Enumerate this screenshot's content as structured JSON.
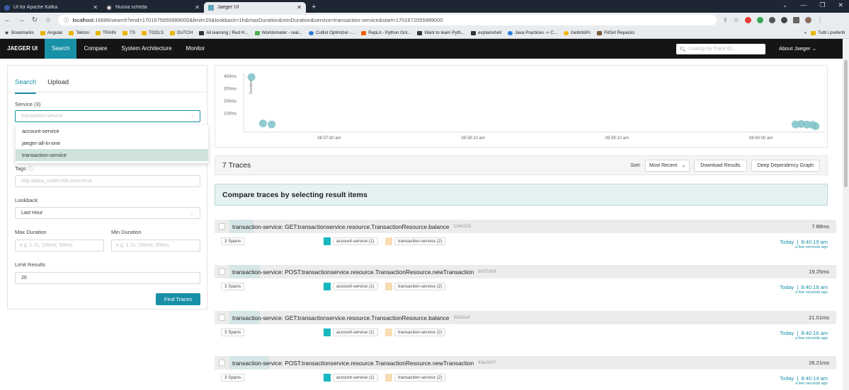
{
  "browser": {
    "tabs": [
      {
        "label": "UI for Apache Kafka",
        "icon": "kafka-icon",
        "active": false
      },
      {
        "label": "Nuova scheda",
        "icon": "chrome-icon",
        "active": false
      },
      {
        "label": "Jaeger UI",
        "icon": "jaeger-icon",
        "active": true
      }
    ],
    "url_host": "localhost",
    "url_rest": ":16686/search?end=1701675655989000&limit=20&lookback=1h&maxDuration&minDuration&service=transaction-service&start=1701672055989000",
    "bookmarks": [
      {
        "label": "Bookmarks",
        "icon": "star"
      },
      {
        "label": "Angular",
        "icon": "folder"
      },
      {
        "label": "Tekton",
        "icon": "folder"
      },
      {
        "label": "TRAIN",
        "icon": "folder"
      },
      {
        "label": "TS",
        "icon": "folder"
      },
      {
        "label": "TOOLS",
        "icon": "folder"
      },
      {
        "label": "DUTCH",
        "icon": "folder"
      },
      {
        "label": "All learning | Red H...",
        "icon": "redhat"
      },
      {
        "label": "Worldometer - real...",
        "icon": "worldometer"
      },
      {
        "label": "Cutlist Optimizer -...",
        "icon": "cutlist"
      },
      {
        "label": "RepLit - Python Onl...",
        "icon": "replit"
      },
      {
        "label": "Want to learn Pyth...",
        "icon": "python"
      },
      {
        "label": "explainshell",
        "icon": "shell"
      },
      {
        "label": "Java Practices -> C...",
        "icon": "java"
      },
      {
        "label": "GetIntoPc",
        "icon": "getintopc"
      },
      {
        "label": "FitGirl Repacks",
        "icon": "fitgirl"
      }
    ],
    "bookmarks_more": "»",
    "bookmarks_other": "Tutti i preferiti"
  },
  "nav": {
    "brand": "JAEGER UI",
    "items": [
      "Search",
      "Compare",
      "System Architecture",
      "Monitor"
    ],
    "lookup_placeholder": "Lookup by Trace ID...",
    "about": "About Jaeger"
  },
  "search": {
    "tab_search": "Search",
    "tab_upload": "Upload",
    "service_label": "Service (3)",
    "service_value": "transaction-service",
    "service_options": [
      "account-service",
      "jaeger-all-in-one",
      "transaction-service"
    ],
    "tags_label": "Tags",
    "tags_placeholder": "http.status_code=200 error=true",
    "lookback_label": "Lookback",
    "lookback_value": "Last Hour",
    "max_label": "Max Duration",
    "min_label": "Min Duration",
    "max_placeholder": "e.g. 1.2s, 100ms, 500us",
    "min_placeholder": "e.g. 1.2s, 100ms, 500us",
    "limit_label": "Limit Results",
    "limit_value": "20",
    "find_button": "Find Traces"
  },
  "chart_data": {
    "type": "scatter",
    "ylabel": "Duration",
    "y_ticks": [
      "400ms",
      "300ms",
      "200ms",
      "100ms"
    ],
    "x_ticks": [
      "08:37:30 am",
      "08:38:20 am",
      "08:39:10 am",
      "08:40:00 am"
    ],
    "points": [
      {
        "x": "08:37:03 am",
        "y": 405
      },
      {
        "x": "08:37:07 am",
        "y": 30
      },
      {
        "x": "08:37:10 am",
        "y": 22
      },
      {
        "x": "08:40:12 am",
        "y": 22
      },
      {
        "x": "08:40:14 am",
        "y": 26
      },
      {
        "x": "08:40:16 am",
        "y": 21
      },
      {
        "x": "08:40:18 am",
        "y": 19
      },
      {
        "x": "08:40:19 am",
        "y": 8
      }
    ],
    "point_color": "#7ec2c7"
  },
  "results": {
    "count": "7 Traces",
    "sort_label": "Sort:",
    "sort_value": "Most Recent",
    "download": "Download Results",
    "deep_dependency": "Deep Dependency Graph",
    "compare_banner": "Compare traces by selecting result items",
    "traces": [
      {
        "name": "transaction-service: GET:transactionservice.resource.TransactionResource.balance",
        "id": "1340325",
        "duration": "7.88ms",
        "duration_fraction": 0.04,
        "spans": "3 Spans",
        "svc1": "account-service (1)",
        "svc2": "transaction-service (2)",
        "day": "Today",
        "time": "8:40:19 am",
        "ago": "a few seconds ago"
      },
      {
        "name": "transaction-service: POST:transactionservice.resource.TransactionResource.newTransaction",
        "id": "6037d09",
        "duration": "19.25ms",
        "duration_fraction": 0.05,
        "spans": "3 Spans",
        "svc1": "account-service (1)",
        "svc2": "transaction-service (2)",
        "day": "Today",
        "time": "8:40:18 am",
        "ago": "a few seconds ago"
      },
      {
        "name": "transaction-service: GET:transactionservice.resource.TransactionResource.balance",
        "id": "9d20cef",
        "duration": "21.01ms",
        "duration_fraction": 0.05,
        "spans": "3 Spans",
        "svc1": "account-service (1)",
        "svc2": "transaction-service (2)",
        "day": "Today",
        "time": "8:40:16 am",
        "ago": "a few seconds ago"
      },
      {
        "name": "transaction-service: POST:transactionservice.resource.TransactionResource.newTransaction",
        "id": "43e0007",
        "duration": "26.21ms",
        "duration_fraction": 0.065,
        "spans": "3 Spans",
        "svc1": "account-service (1)",
        "svc2": "transaction-service (2)",
        "day": "Today",
        "time": "8:40:14 am",
        "ago": "a few seconds ago"
      }
    ]
  },
  "colors": {
    "accent": "#1890a8",
    "account_service": "#17b8be",
    "transaction_service": "#f8dcb3"
  }
}
